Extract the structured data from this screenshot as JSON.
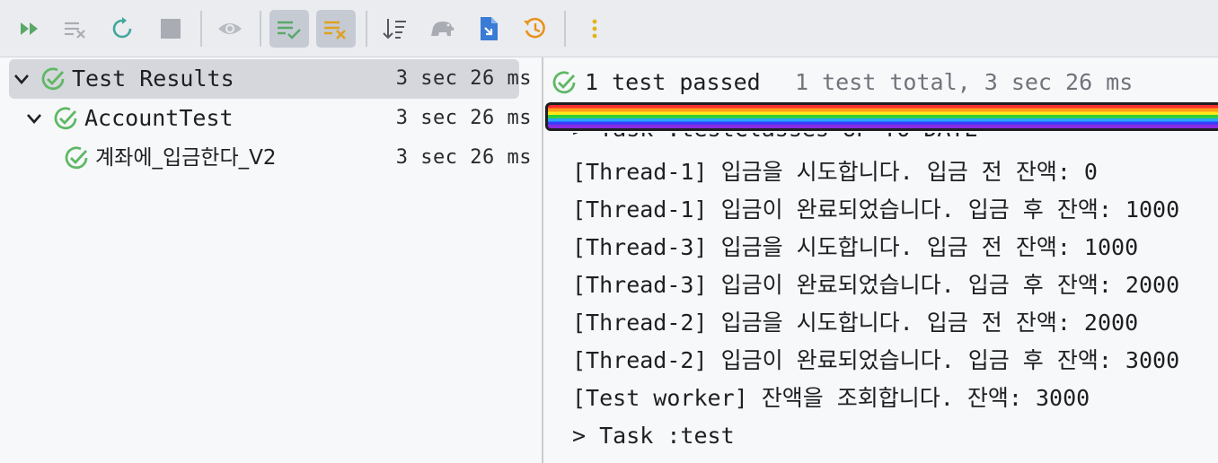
{
  "toolbar": {
    "buttons": [
      {
        "name": "rerun-tests-button",
        "icon": "double-play-icon"
      },
      {
        "name": "rerun-failed-button",
        "icon": "list-x-icon"
      },
      {
        "name": "toggle-auto-test-button",
        "icon": "refresh-icon"
      },
      {
        "name": "stop-button",
        "icon": "stop-square-icon"
      },
      {
        "name": "show-ignored-button",
        "icon": "eye-icon"
      },
      {
        "name": "show-passed-button",
        "icon": "list-check-icon",
        "active": true
      },
      {
        "name": "show-failed-button",
        "icon": "list-x-orange-icon",
        "active": true
      },
      {
        "name": "sort-button",
        "icon": "sort-icon"
      },
      {
        "name": "import-tests-button",
        "icon": "elephant-icon"
      },
      {
        "name": "export-results-button",
        "icon": "export-file-icon"
      },
      {
        "name": "test-history-button",
        "icon": "history-clock-icon"
      },
      {
        "name": "more-options-button",
        "icon": "vertical-dots-icon"
      }
    ]
  },
  "tree": [
    {
      "label": "Test Results",
      "time": "3 sec 26 ms",
      "status": "passed",
      "expanded": true,
      "selected": true
    },
    {
      "label": "AccountTest",
      "time": "3 sec 26 ms",
      "status": "passed",
      "expanded": true,
      "selected": false
    },
    {
      "label": "계좌에_입금한다_V2",
      "time": "3 sec 26 ms",
      "status": "passed",
      "selected": false
    }
  ],
  "status": {
    "passed_text": "1 test passed",
    "total_text": "1 test total, 3 sec 26 ms"
  },
  "console": {
    "lines": [
      "> Task :testClasses UP-TO-DATE",
      "[Thread-1] 입금을 시도합니다. 입금 전 잔액: 0",
      "[Thread-1] 입금이 완료되었습니다. 입금 후 잔액: 1000",
      "[Thread-3] 입금을 시도합니다. 입금 전 잔액: 1000",
      "[Thread-3] 입금이 완료되었습니다. 입금 후 잔액: 2000",
      "[Thread-2] 입금을 시도합니다. 입금 전 잔액: 2000",
      "[Thread-2] 입금이 완료되었습니다. 입금 후 잔액: 3000",
      "[Test worker] 잔액을 조회합니다. 잔액: 3000",
      "> Task :test"
    ]
  },
  "colors": {
    "passed_green": "#5fb865",
    "toolbar_bg": "#ebecf0",
    "panel_bg": "#f7f8fa",
    "selection_bg": "#d5d7dc"
  }
}
